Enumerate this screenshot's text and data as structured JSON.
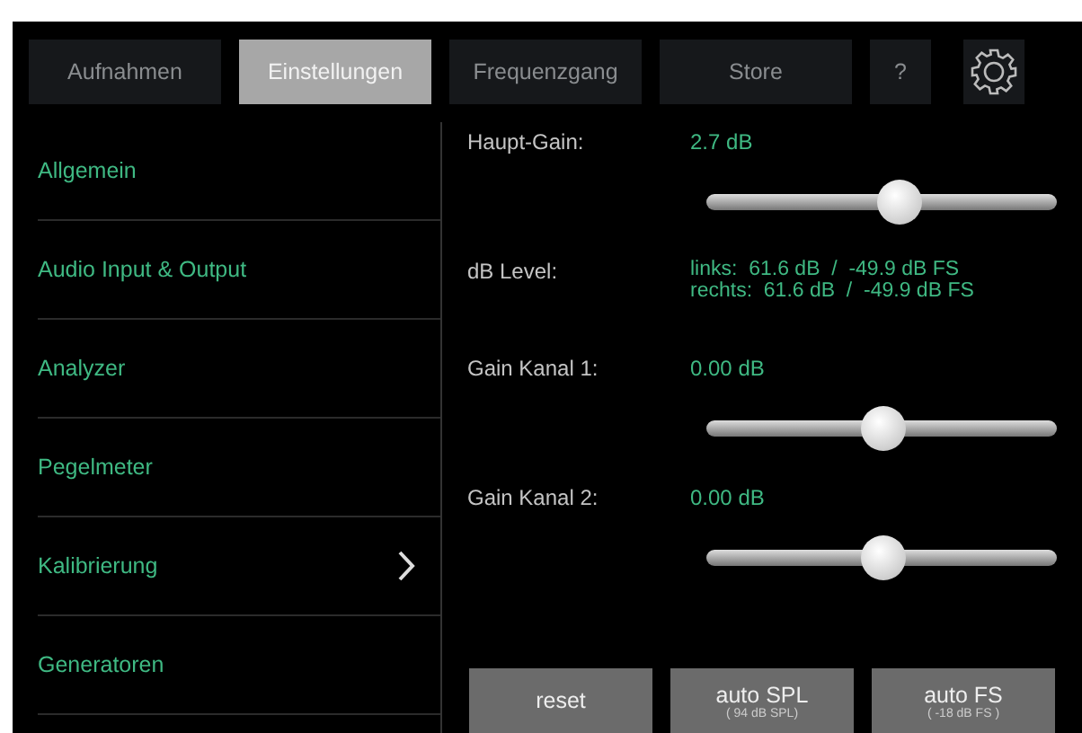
{
  "tabs": [
    {
      "label": "Aufnahmen",
      "selected": false
    },
    {
      "label": "Einstellungen",
      "selected": true
    },
    {
      "label": "Frequenzgang",
      "selected": false
    },
    {
      "label": "Store",
      "selected": false
    },
    {
      "label": "?",
      "selected": false
    }
  ],
  "sidebar": {
    "items": [
      {
        "label": "Allgemein",
        "selected": false
      },
      {
        "label": "Audio Input & Output",
        "selected": false
      },
      {
        "label": "Analyzer",
        "selected": false
      },
      {
        "label": "Pegelmeter",
        "selected": false
      },
      {
        "label": "Kalibrierung",
        "selected": true
      },
      {
        "label": "Generatoren",
        "selected": false
      }
    ]
  },
  "settings": [
    {
      "kind": "slider",
      "label": "Haupt-Gain:",
      "value": "2.7 dB",
      "level": 0.55
    },
    {
      "kind": "readout",
      "label": "dB Level:",
      "lines": [
        "links:  61.6 dB  /  -49.9 dB FS",
        "rechts:  61.6 dB  /  -49.9 dB FS"
      ]
    },
    {
      "kind": "slider",
      "label": "Gain Kanal 1:",
      "value": "0.00 dB",
      "level": 0.5
    },
    {
      "kind": "slider",
      "label": "Gain Kanal 2:",
      "value": "0.00 dB",
      "level": 0.5
    }
  ],
  "buttons": [
    {
      "label": "reset"
    },
    {
      "label": "auto SPL",
      "sublabel": "( 94 dB SPL)"
    },
    {
      "label": "auto FS",
      "sublabel": "( -18 dB FS )"
    }
  ]
}
